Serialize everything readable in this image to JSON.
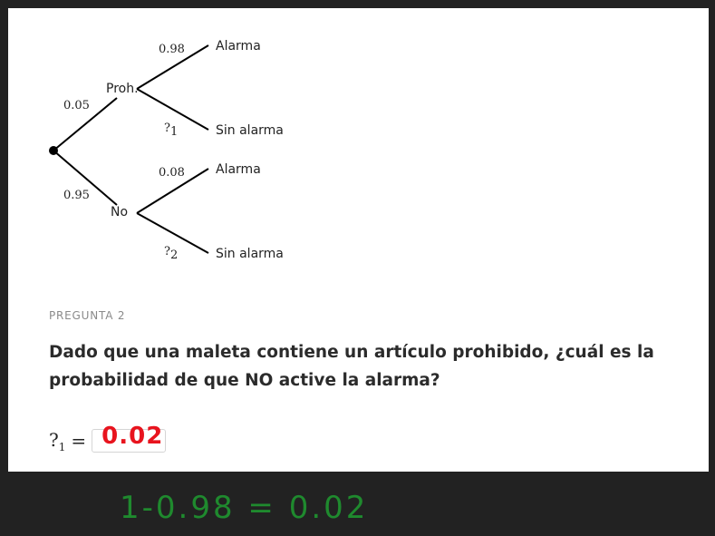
{
  "tree": {
    "root_branches": [
      {
        "prob": "0.05",
        "label": "Proh."
      },
      {
        "prob": "0.95",
        "label": "No"
      }
    ],
    "proh_branches": [
      {
        "prob": "0.98",
        "label": "Alarma"
      },
      {
        "prob": "?",
        "prob_sub": "1",
        "label": "Sin alarma"
      }
    ],
    "no_branches": [
      {
        "prob": "0.08",
        "label": "Alarma"
      },
      {
        "prob": "?",
        "prob_sub": "2",
        "label": "Sin alarma"
      }
    ]
  },
  "question": {
    "kicker": "PREGUNTA 2",
    "text": "Dado que una maleta contiene un artículo prohibido, ¿cuál es la probabilidad de que NO active la alarma?"
  },
  "answer": {
    "variable": "?",
    "variable_sub": "1",
    "equals": "=",
    "handwritten_value": "0.02"
  },
  "scratch": {
    "handwritten_note": "1-0.98 = 0.02"
  },
  "colors": {
    "answer_ink": "#e8141e",
    "scratch_ink": "#1f8a2e",
    "background": "#222222",
    "card": "#ffffff"
  }
}
